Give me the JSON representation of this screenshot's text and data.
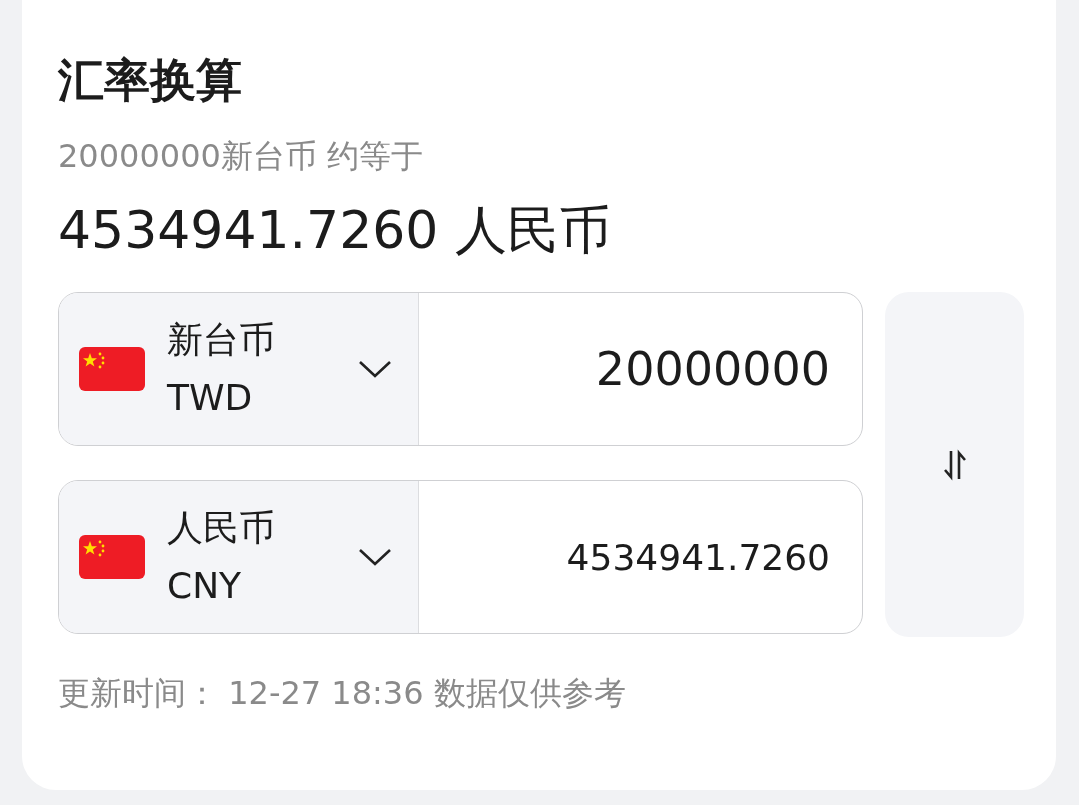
{
  "title": "汇率换算",
  "summary": "20000000新台币 约等于",
  "result": "4534941.7260 人民币",
  "rows": [
    {
      "currency_name": "新台币",
      "code": "TWD",
      "amount": "20000000",
      "emphasis": true
    },
    {
      "currency_name": "人民币",
      "code": "CNY",
      "amount": "4534941.7260",
      "emphasis": false
    }
  ],
  "footer": "更新时间： 12-27 18:36 数据仅供参考"
}
